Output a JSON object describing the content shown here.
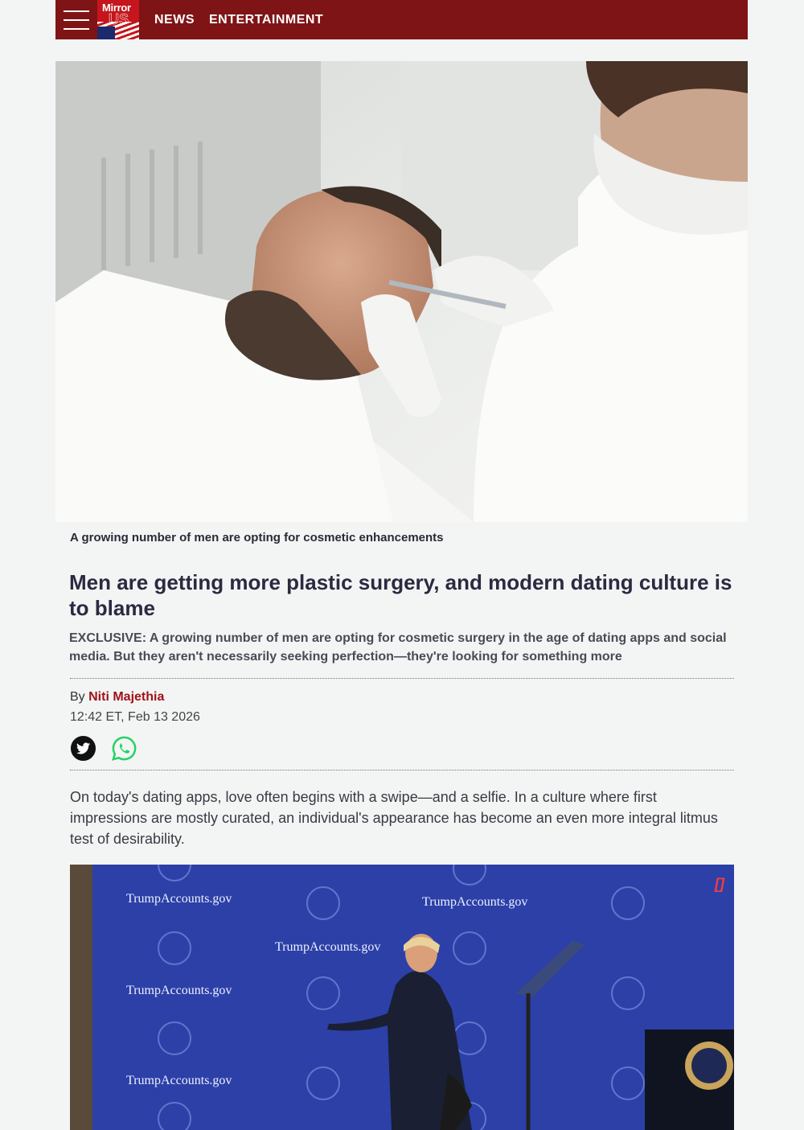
{
  "header": {
    "logo_top": "Mirror",
    "logo_bottom": "US",
    "nav": [
      "NEWS",
      "ENTERTAINMENT"
    ]
  },
  "hero": {
    "caption": "A growing number of men are opting for cosmetic enhancements"
  },
  "article": {
    "headline": "Men are getting more plastic surgery, and modern dating culture is to blame",
    "standfirst": "EXCLUSIVE: A growing number of men are opting for cosmetic surgery in the age of dating apps and social media. But they aren't necessarily seeking perfection—they're looking for something more",
    "by_label": "By",
    "author": "Niti Majethia",
    "timestamp": "12:42 ET, Feb 13 2026",
    "body": "On today's dating apps, love often begins with a swipe—and a selfie. In a culture where first impressions are mostly curated, an individual's appearance has become an even more integral litmus test of desirability."
  },
  "video": {
    "backdrop_text": "TrumpAccounts.gov",
    "corner_mark": "[]"
  },
  "colors": {
    "header_bg": "#7f1416",
    "author": "#a01218",
    "whatsapp": "#25d366"
  }
}
